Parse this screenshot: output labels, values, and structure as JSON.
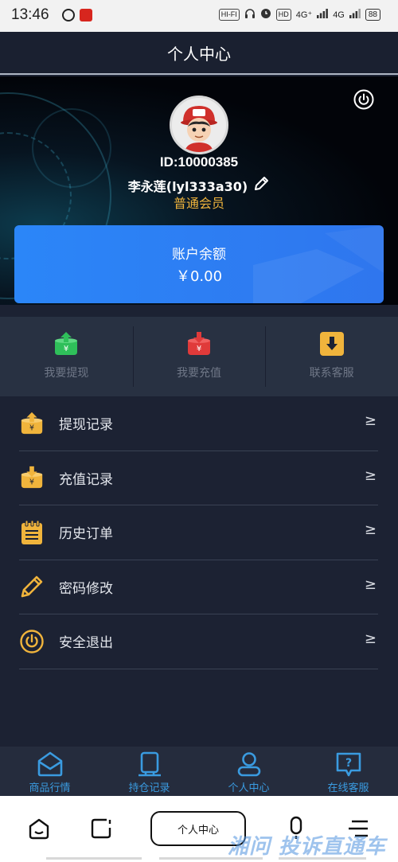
{
  "status_bar": {
    "time": "13:46",
    "hifi": "HI-FI",
    "hd_badge": "HD",
    "signal1": "4G⁺",
    "signal2": "4G",
    "battery": "88"
  },
  "header": {
    "title": "个人中心"
  },
  "profile": {
    "id_text": "ID:10000385",
    "name": "李永莲(lyl333a30)",
    "level": "普通会员"
  },
  "balance": {
    "label": "账户余额",
    "amount": "￥0.00"
  },
  "quick_actions": [
    {
      "label": "我要提现",
      "icon": "withdraw-icon",
      "color": "#2fbf5a"
    },
    {
      "label": "我要充值",
      "icon": "recharge-icon",
      "color": "#e03a3a"
    },
    {
      "label": "联系客服",
      "icon": "contact-icon",
      "color": "#f0b43c"
    }
  ],
  "menu": [
    {
      "label": "提现记录",
      "icon": "withdraw-record-icon",
      "arrow": "≥"
    },
    {
      "label": "充值记录",
      "icon": "recharge-record-icon",
      "arrow": "≥"
    },
    {
      "label": "历史订单",
      "icon": "order-history-icon",
      "arrow": "≥"
    },
    {
      "label": "密码修改",
      "icon": "pencil-icon",
      "arrow": "≥"
    },
    {
      "label": "安全退出",
      "icon": "power-icon",
      "arrow": "≥"
    }
  ],
  "tabs": [
    {
      "label": "商品行情",
      "icon": "market-icon"
    },
    {
      "label": "持仓记录",
      "icon": "holding-icon"
    },
    {
      "label": "个人中心",
      "icon": "user-icon"
    },
    {
      "label": "在线客服",
      "icon": "support-icon"
    }
  ],
  "system_nav": {
    "pill_label": "个人中心",
    "watermark": "湘问 投诉直通车"
  },
  "colors": {
    "accent_blue": "#2b86f8",
    "gold": "#f0b43c",
    "tab_blue": "#3a9be0",
    "background": "#1c2233"
  }
}
